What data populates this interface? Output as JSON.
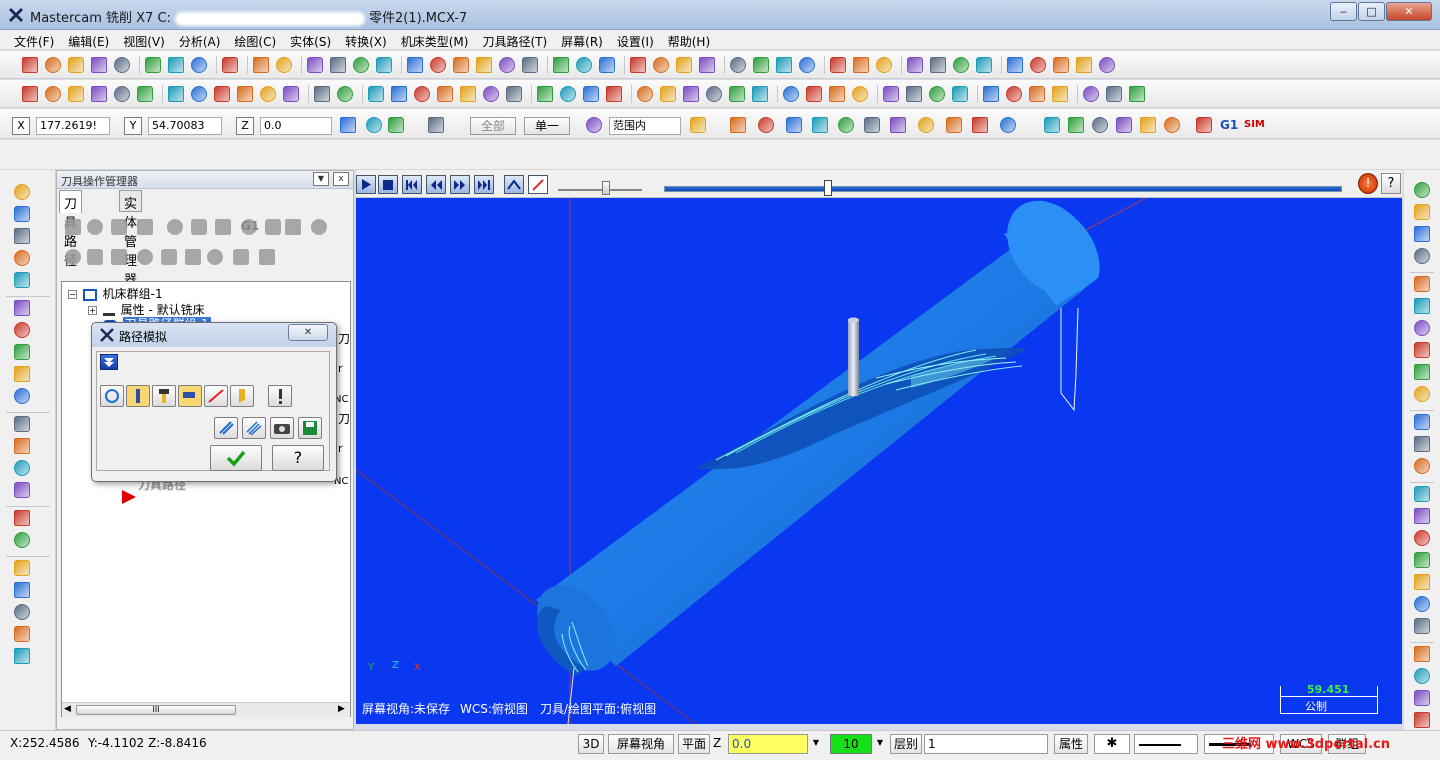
{
  "window": {
    "title_prefix": "Mastercam 铣削 X7",
    "title_drive": "C:",
    "title_file": "零件2(1).MCX-7",
    "min": "‒",
    "max": "□",
    "close": "✕"
  },
  "menu": [
    "文件(F)",
    "编辑(E)",
    "视图(V)",
    "分析(A)",
    "绘图(C)",
    "实体(S)",
    "转换(X)",
    "机床类型(M)",
    "刀具路径(T)",
    "屏幕(R)",
    "设置(I)",
    "帮助(H)"
  ],
  "coords": {
    "x_label": "X",
    "x_value": "177.2619!",
    "y_label": "Y",
    "y_value": "54.70083",
    "z_label": "Z",
    "z_value": "0.0",
    "btn_all": "全部",
    "btn_single": "单一",
    "range": "范围内",
    "g1": "G1",
    "sim": "SIM"
  },
  "manager": {
    "title": "刀具操作管理器",
    "tab_toolpath": "刀具路径",
    "tab_solid": "实体管理器",
    "g1": "G1",
    "tree": [
      {
        "label": "机床群组-1"
      },
      {
        "label": "属性 - 默认铣床"
      },
      {
        "label": "刀具路径群组-1"
      },
      {
        "label": "刀具路径"
      }
    ],
    "partial": [
      "刀",
      "r",
      "NC",
      "刀",
      "r",
      "NC"
    ],
    "scroll_mid": "III"
  },
  "dialog": {
    "title": "路径模拟",
    "close": "✕"
  },
  "viewport": {
    "status_view": "屏幕视角:未保存",
    "status_wcs": "WCS:俯视图",
    "status_plane": "刀具/绘图平面:俯视图",
    "scale_value": "59.451",
    "scale_unit": "公制",
    "axis_y": "Y",
    "axis_z": "Z",
    "axis_x": "X"
  },
  "statusbar": {
    "x": "X:252.4586",
    "y": "Y:-4.1102",
    "z": "Z:-8.8416",
    "mode_3d": "3D",
    "screen_view": "屏幕视角",
    "plane": "平面",
    "z_label": "Z",
    "z_value": "0.0",
    "color_value": "10",
    "level_label": "层别",
    "level_value": "1",
    "attrs": "属性",
    "wcs": "WCS",
    "group": "群组",
    "watermark": "三维网 www.3dportal.cn"
  },
  "colors": {
    "viewport_bg": "#0a37f0",
    "part_blue": "#1e7fe8",
    "toolpath_cyan": "#5fe0e8"
  }
}
